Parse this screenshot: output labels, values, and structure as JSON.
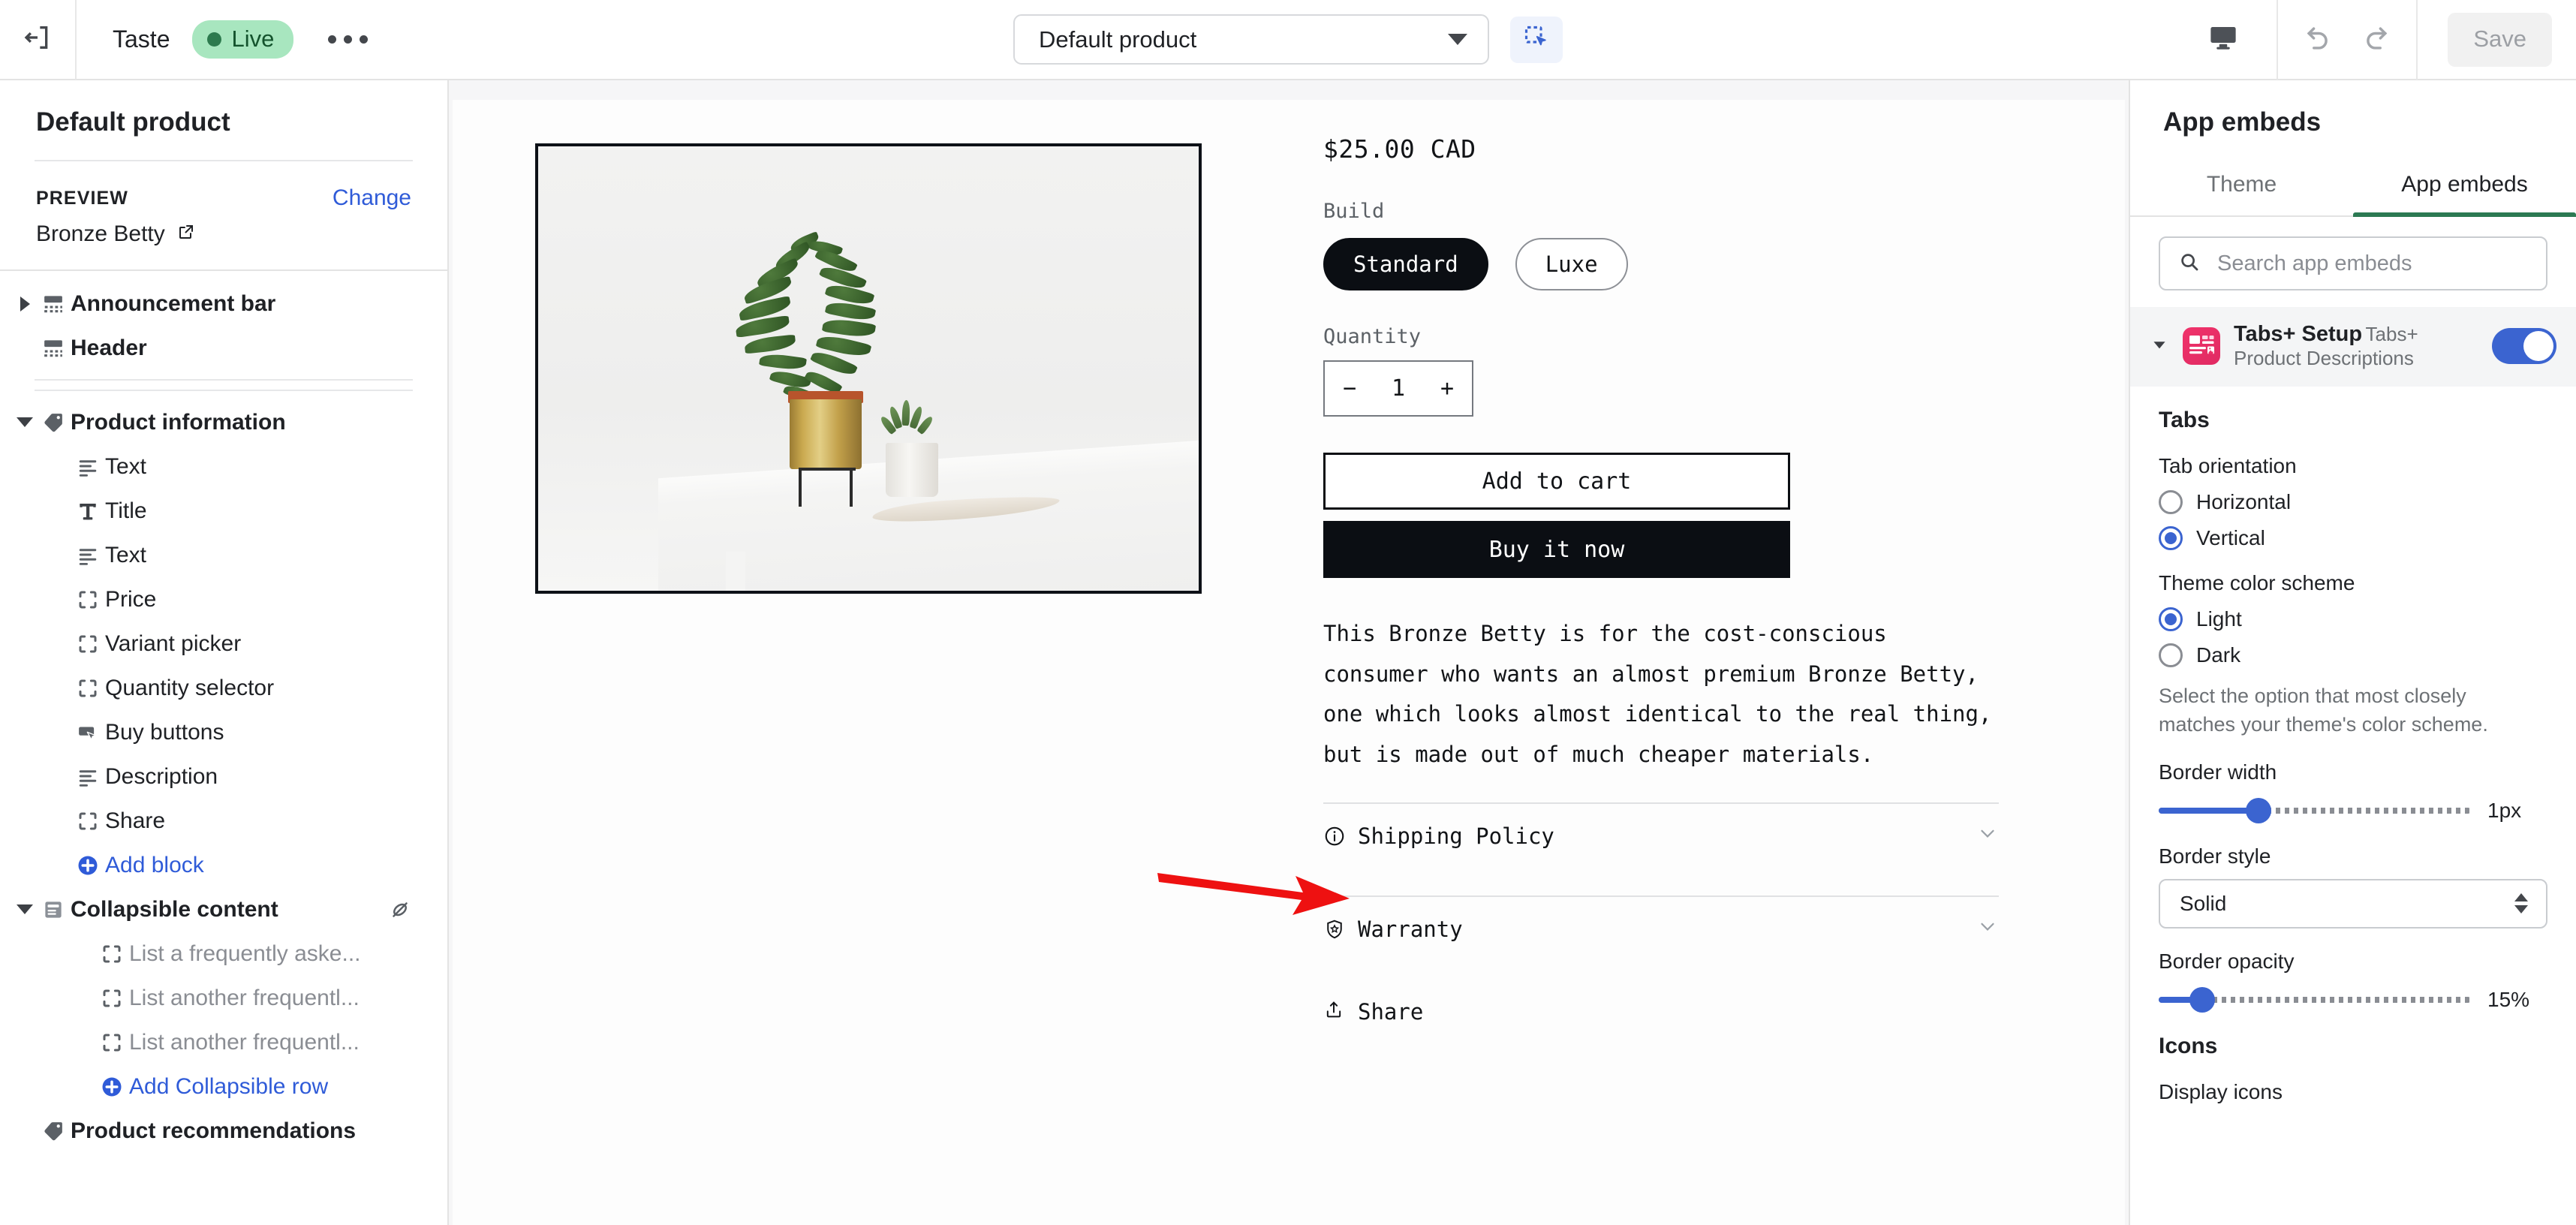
{
  "topbar": {
    "exit_icon": "exit-to-app-icon",
    "shop_name": "Taste",
    "status_badge": "Live",
    "more_icon": "more-horizontal-icon",
    "product_selector_value": "Default product",
    "inspector_icon": "inspector-select-icon",
    "device_icon": "desktop-icon",
    "undo_icon": "undo-icon",
    "redo_icon": "redo-icon",
    "save_label": "Save"
  },
  "sidebar": {
    "title": "Default product",
    "preview_label": "PREVIEW",
    "preview_change": "Change",
    "preview_value": "Bronze Betty",
    "external_link_icon": "external-link-icon",
    "items": [
      {
        "label": "Announcement bar",
        "level": 1,
        "icon": "section-icon",
        "twist": "right",
        "style": "bold"
      },
      {
        "label": "Header",
        "level": 1,
        "icon": "section-icon",
        "twist": "none",
        "style": "bold"
      },
      {
        "label": "Product information",
        "level": 1,
        "icon": "tag-icon",
        "twist": "down",
        "style": "bold"
      },
      {
        "label": "Text",
        "level": 2,
        "icon": "text-lines-icon",
        "twist": "none",
        "style": "normal"
      },
      {
        "label": "Title",
        "level": 2,
        "icon": "title-t-icon",
        "twist": "none",
        "style": "normal"
      },
      {
        "label": "Text",
        "level": 2,
        "icon": "text-lines-icon",
        "twist": "none",
        "style": "normal"
      },
      {
        "label": "Price",
        "level": 2,
        "icon": "block-brackets-icon",
        "twist": "none",
        "style": "normal"
      },
      {
        "label": "Variant picker",
        "level": 2,
        "icon": "block-brackets-icon",
        "twist": "none",
        "style": "normal"
      },
      {
        "label": "Quantity selector",
        "level": 2,
        "icon": "block-brackets-icon",
        "twist": "none",
        "style": "normal"
      },
      {
        "label": "Buy buttons",
        "level": 2,
        "icon": "button-cursor-icon",
        "twist": "none",
        "style": "normal"
      },
      {
        "label": "Description",
        "level": 2,
        "icon": "text-lines-icon",
        "twist": "none",
        "style": "normal"
      },
      {
        "label": "Share",
        "level": 2,
        "icon": "block-brackets-icon",
        "twist": "none",
        "style": "normal"
      },
      {
        "label": "Add block",
        "level": 2,
        "icon": "add-circle-icon",
        "twist": "none",
        "style": "link"
      },
      {
        "label": "Collapsible content",
        "level": 1,
        "icon": "collapsible-icon",
        "twist": "down",
        "style": "bold",
        "hidden_icon": "hidden-eye-icon"
      },
      {
        "label": "List a frequently aske...",
        "level": 3,
        "icon": "block-brackets-icon",
        "twist": "none",
        "style": "muted"
      },
      {
        "label": "List another frequentl...",
        "level": 3,
        "icon": "block-brackets-icon",
        "twist": "none",
        "style": "muted"
      },
      {
        "label": "List another frequentl...",
        "level": 3,
        "icon": "block-brackets-icon",
        "twist": "none",
        "style": "muted"
      },
      {
        "label": "Add Collapsible row",
        "level": 3,
        "icon": "add-circle-icon",
        "twist": "none",
        "style": "link"
      },
      {
        "label": "Product recommendations",
        "level": 1,
        "icon": "tag-icon",
        "twist": "none",
        "style": "bold"
      }
    ]
  },
  "preview": {
    "product_image_alt": "Potted plant on white table",
    "price": "$25.00 CAD",
    "option_label": "Build",
    "variants": [
      {
        "label": "Standard",
        "selected": true
      },
      {
        "label": "Luxe",
        "selected": false
      }
    ],
    "quantity_label": "Quantity",
    "quantity_minus": "−",
    "quantity_value": "1",
    "quantity_plus": "+",
    "add_to_cart": "Add to cart",
    "buy_it_now": "Buy it now",
    "description": "This Bronze Betty is for the cost-conscious consumer who wants an almost premium Bronze Betty, one which looks almost identical to the real thing, but is made out of much cheaper materials.",
    "accordions": [
      {
        "label": "Shipping Policy",
        "icon": "info-circle-icon",
        "chevron": "chevron-down-icon"
      },
      {
        "label": "Warranty",
        "icon": "shield-star-icon",
        "chevron": "chevron-down-icon"
      }
    ],
    "share_label": "Share",
    "share_icon": "share-upload-icon",
    "annotation_arrow_color": "#ee1111"
  },
  "rightpanel": {
    "title": "App embeds",
    "tabs": [
      {
        "label": "Theme",
        "active": false
      },
      {
        "label": "App embeds",
        "active": true
      }
    ],
    "search_placeholder": "Search app embeds",
    "search_value": "",
    "search_icon": "search-icon",
    "embed": {
      "name": "Tabs+ Setup",
      "subtitle": "Tabs+ Product Descriptions",
      "app_icon": "tabs-plus-app-icon",
      "app_icon_color": "#ec3268",
      "toggle_on": true,
      "twist": "down"
    },
    "sections": {
      "tabs_heading": "Tabs",
      "tab_orientation_label": "Tab orientation",
      "tab_orientation_options": [
        {
          "label": "Horizontal",
          "selected": false
        },
        {
          "label": "Vertical",
          "selected": true
        }
      ],
      "theme_color_label": "Theme color scheme",
      "theme_color_options": [
        {
          "label": "Light",
          "selected": true
        },
        {
          "label": "Dark",
          "selected": false
        }
      ],
      "theme_color_help": "Select the option that most closely matches your theme's color scheme.",
      "border_width_label": "Border width",
      "border_width_value": "1px",
      "border_width_percent": 32,
      "border_style_label": "Border style",
      "border_style_value": "Solid",
      "border_opacity_label": "Border opacity",
      "border_opacity_value": "15%",
      "border_opacity_percent": 14,
      "icons_heading": "Icons",
      "display_icons_label": "Display icons"
    },
    "accent_color": "#3b64d0",
    "active_tab_color": "#2c7a53"
  }
}
